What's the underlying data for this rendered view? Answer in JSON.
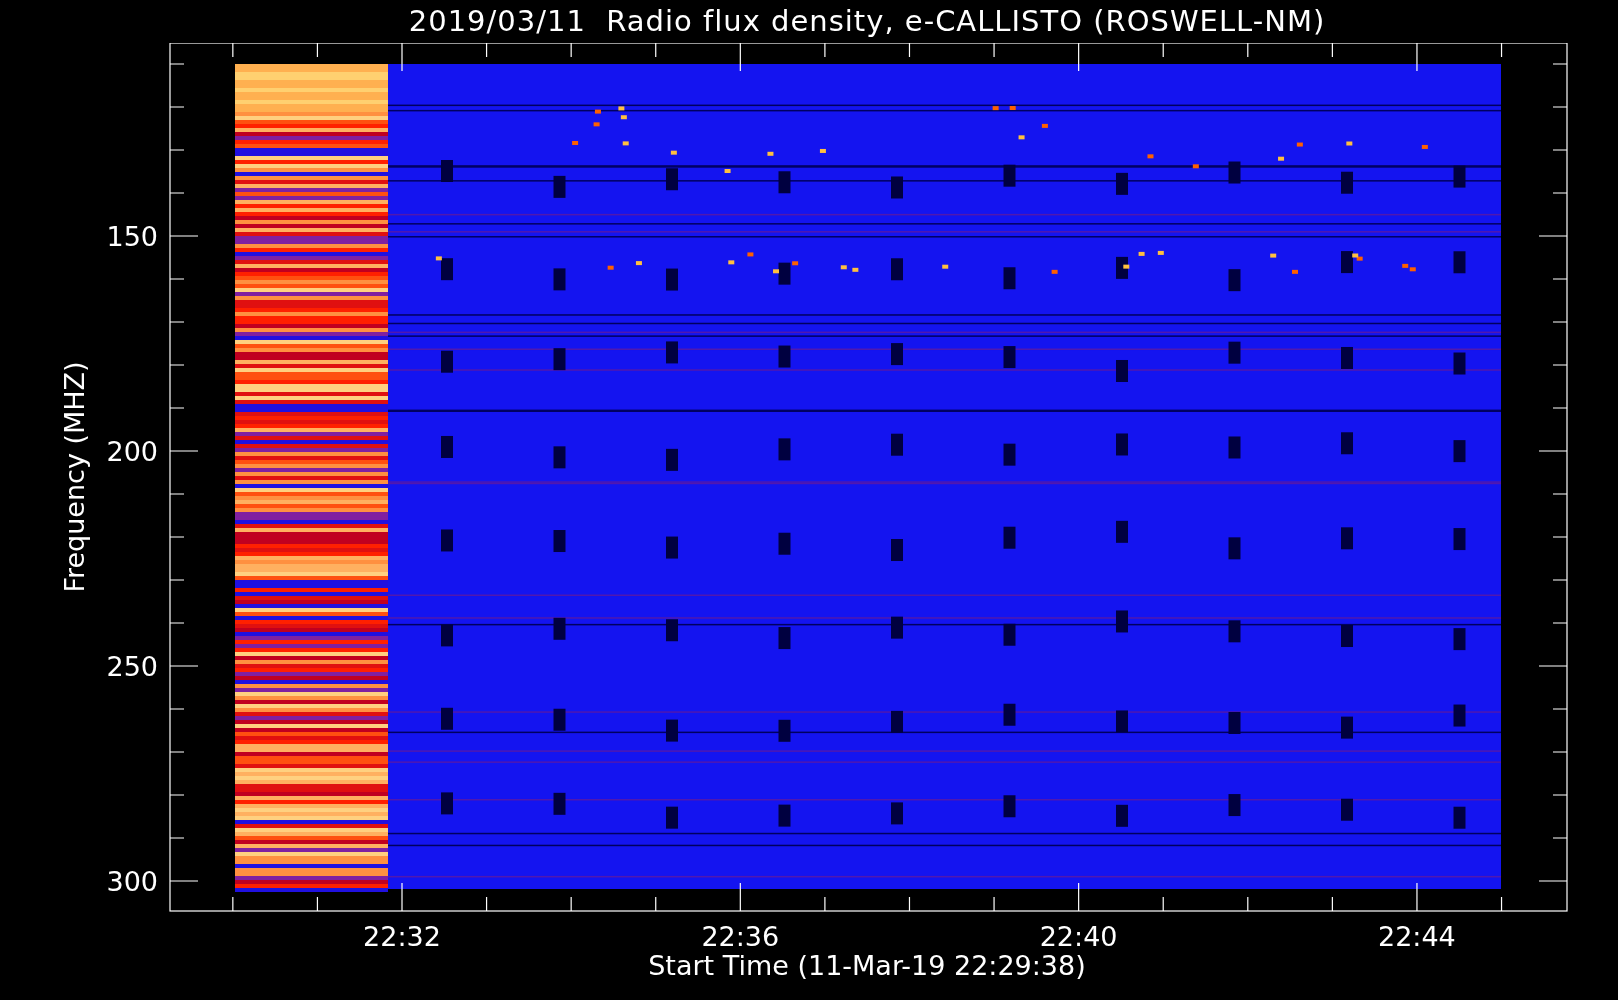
{
  "title": "2019/03/11  Radio flux density, e-CALLISTO (ROSWELL-NM)",
  "y_axis": {
    "label": "Frequency (MHZ)",
    "ticks": [
      "150",
      "200",
      "250",
      "300"
    ]
  },
  "x_axis": {
    "label": "Start Time (11-Mar-19 22:29:38)",
    "ticks": [
      "22:32",
      "22:36",
      "22:40",
      "22:44"
    ]
  }
}
